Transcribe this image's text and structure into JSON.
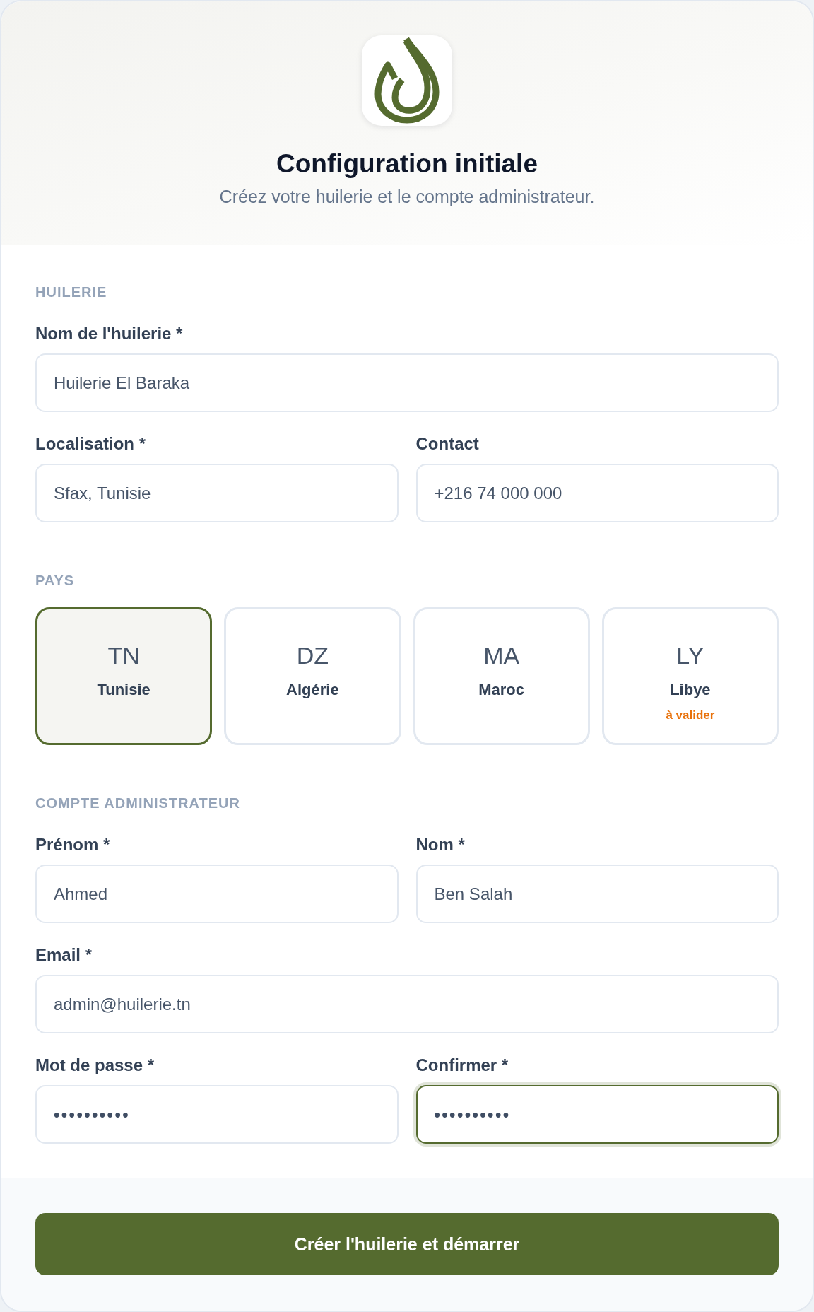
{
  "header": {
    "title": "Configuration initiale",
    "subtitle": "Créez votre huilerie et le compte administrateur."
  },
  "sections": [
    {
      "kind": "fields",
      "heading": "HUILERIE",
      "rows": [
        {
          "fields": [
            {
              "kind": "text",
              "label": "Nom de l'huilerie *",
              "value": "Huilerie El Baraka",
              "focused": false
            }
          ]
        },
        {
          "fields": [
            {
              "kind": "text",
              "label": "Localisation *",
              "value": "Sfax, Tunisie",
              "focused": false
            },
            {
              "kind": "text",
              "label": "Contact",
              "value": "+216 74 000 000",
              "focused": false
            }
          ]
        }
      ]
    },
    {
      "kind": "countries",
      "heading": "PAYS",
      "countries": [
        {
          "code": "TN",
          "name": "Tunisie",
          "selected": true
        },
        {
          "code": "DZ",
          "name": "Algérie",
          "selected": false
        },
        {
          "code": "MA",
          "name": "Maroc",
          "selected": false
        },
        {
          "code": "LY",
          "name": "Libye",
          "note": "à valider",
          "selected": false
        }
      ]
    },
    {
      "kind": "fields",
      "heading": "COMPTE ADMINISTRATEUR",
      "rows": [
        {
          "fields": [
            {
              "kind": "text",
              "label": "Prénom *",
              "value": "Ahmed",
              "focused": false
            },
            {
              "kind": "text",
              "label": "Nom *",
              "value": "Ben Salah",
              "focused": false
            }
          ]
        },
        {
          "fields": [
            {
              "kind": "text",
              "label": "Email *",
              "value": "admin@huilerie.tn",
              "focused": false
            }
          ]
        },
        {
          "fields": [
            {
              "kind": "password",
              "label": "Mot de passe *",
              "value": "••••••••••",
              "focused": false
            },
            {
              "kind": "password",
              "label": "Confirmer *",
              "value": "••••••••••",
              "focused": true
            }
          ]
        }
      ]
    }
  ],
  "submit_button": "Créer l'huilerie et démarrer"
}
